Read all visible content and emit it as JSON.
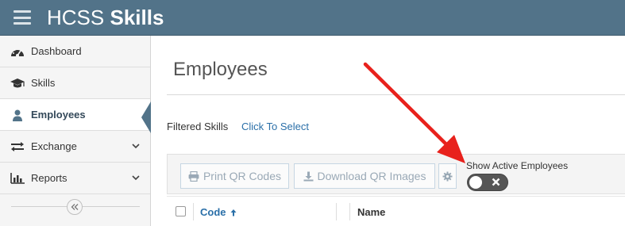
{
  "header": {
    "brand_prefix": "HCSS",
    "brand_name": "Skills",
    "bar_color": "#527389"
  },
  "sidebar": {
    "items": [
      {
        "label": "Dashboard",
        "icon": "dashboard-icon",
        "active": false,
        "has_chevron": false
      },
      {
        "label": "Skills",
        "icon": "graduation-cap-icon",
        "active": false,
        "has_chevron": false
      },
      {
        "label": "Employees",
        "icon": "user-icon",
        "active": true,
        "has_chevron": false
      },
      {
        "label": "Exchange",
        "icon": "exchange-icon",
        "active": false,
        "has_chevron": true
      },
      {
        "label": "Reports",
        "icon": "bar-chart-icon",
        "active": false,
        "has_chevron": true
      }
    ],
    "collapse_icon": "double-chevron-left-icon"
  },
  "main": {
    "page_title": "Employees",
    "filter": {
      "label": "Filtered Skills",
      "link_text": "Click To Select"
    },
    "toolbar": {
      "print_label": "Print QR Codes",
      "print_icon": "print-icon",
      "download_label": "Download QR Images",
      "download_icon": "download-icon",
      "settings_icon": "gear-icon"
    },
    "active_toggle": {
      "label": "Show Active Employees",
      "on": false
    },
    "table": {
      "columns": [
        {
          "label": "Code",
          "sorted": "ascending"
        },
        {
          "label": "Name"
        }
      ]
    }
  },
  "annotation": {
    "arrow_color": "#e8211c"
  }
}
